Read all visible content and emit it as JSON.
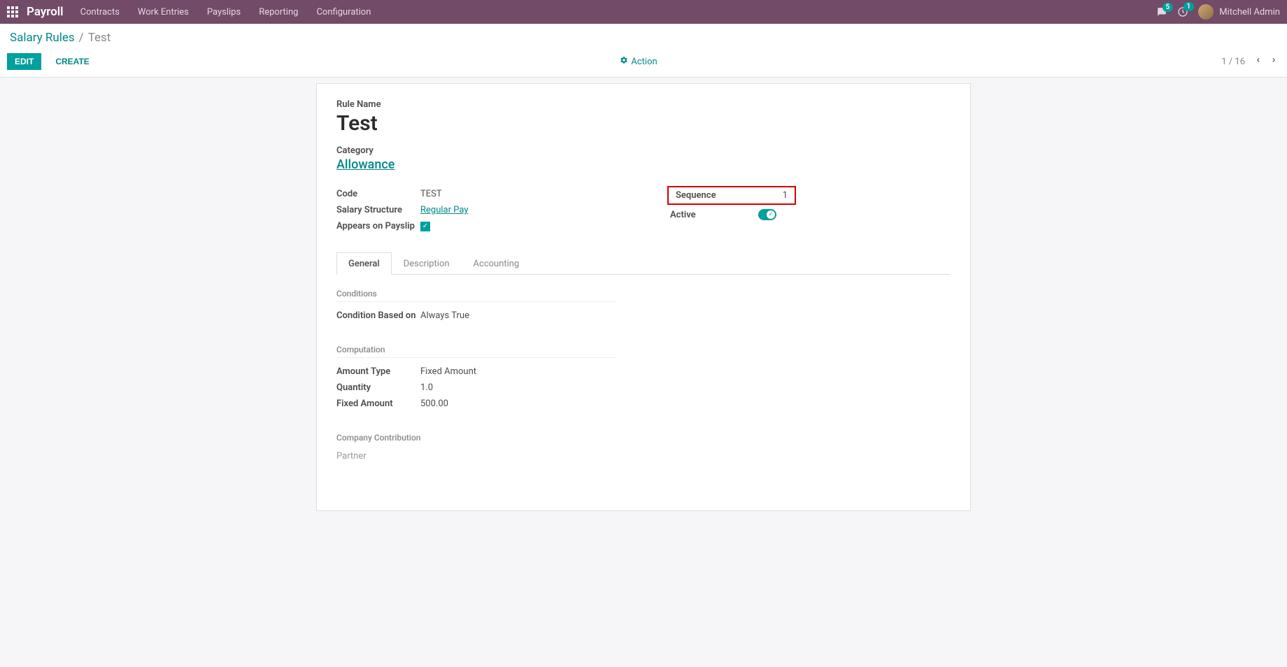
{
  "header": {
    "brand": "Payroll",
    "menu": [
      "Contracts",
      "Work Entries",
      "Payslips",
      "Reporting",
      "Configuration"
    ],
    "chat_badge": "5",
    "notif_badge": "1",
    "user_name": "Mitchell Admin"
  },
  "breadcrumb": {
    "parent": "Salary Rules",
    "current": "Test"
  },
  "controls": {
    "edit": "EDIT",
    "create": "CREATE",
    "action": "Action",
    "pager": "1 / 16"
  },
  "form": {
    "rule_name_label": "Rule Name",
    "rule_name": "Test",
    "category_label": "Category",
    "category": "Allowance",
    "left": {
      "code_label": "Code",
      "code": "TEST",
      "salary_structure_label": "Salary Structure",
      "salary_structure": "Regular Pay",
      "appears_label": "Appears on Payslip"
    },
    "right": {
      "sequence_label": "Sequence",
      "sequence": "1",
      "active_label": "Active"
    },
    "tabs": [
      "General",
      "Description",
      "Accounting"
    ],
    "general": {
      "conditions_heading": "Conditions",
      "condition_based_label": "Condition Based on",
      "condition_based_value": "Always True",
      "computation_heading": "Computation",
      "amount_type_label": "Amount Type",
      "amount_type_value": "Fixed Amount",
      "quantity_label": "Quantity",
      "quantity_value": "1.0",
      "fixed_amount_label": "Fixed Amount",
      "fixed_amount_value": "500.00",
      "company_contribution_heading": "Company Contribution",
      "partner": "Partner"
    }
  }
}
